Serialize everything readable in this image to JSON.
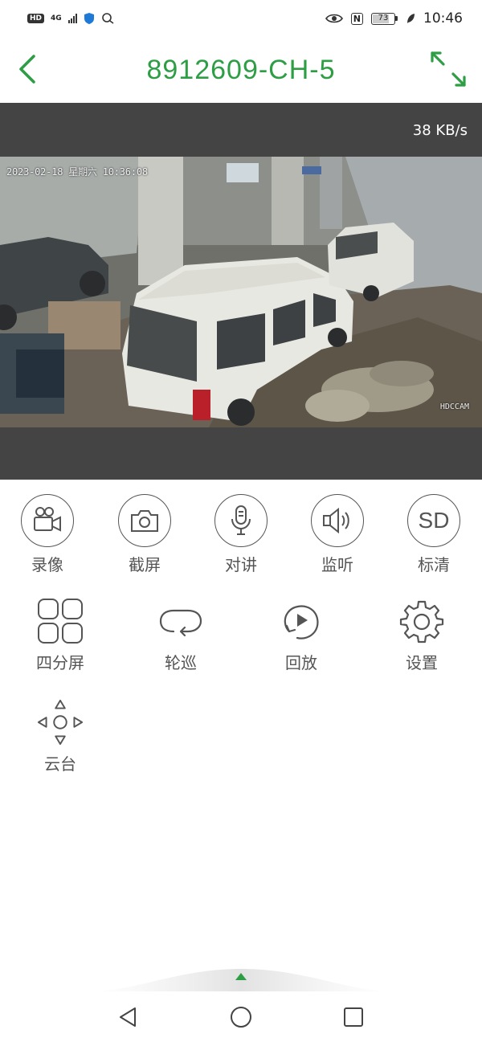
{
  "status_bar": {
    "hd_badge": "HD",
    "network_type": "4G",
    "battery_level": "73",
    "time": "10:46",
    "nfc": "N"
  },
  "header": {
    "title": "8912609-CH-5",
    "accent_color": "#2e9e45"
  },
  "video": {
    "bitrate": "38 KB/s",
    "osd_timestamp": "2023-02-18 星期六 10:36:08",
    "osd_camera_name": "HDCCAM"
  },
  "controls": {
    "record": {
      "label": "录像",
      "icon": "video-camera-icon"
    },
    "screenshot": {
      "label": "截屏",
      "icon": "camera-icon"
    },
    "talk": {
      "label": "对讲",
      "icon": "microphone-icon"
    },
    "listen": {
      "label": "监听",
      "icon": "speaker-icon"
    },
    "quality": {
      "label": "标清",
      "badge": "SD"
    },
    "quad": {
      "label": "四分屏",
      "icon": "grid-icon"
    },
    "patrol": {
      "label": "轮巡",
      "icon": "loop-icon"
    },
    "playback": {
      "label": "回放",
      "icon": "replay-icon"
    },
    "settings": {
      "label": "设置",
      "icon": "gear-icon"
    },
    "ptz": {
      "label": "云台",
      "icon": "dpad-icon"
    }
  }
}
